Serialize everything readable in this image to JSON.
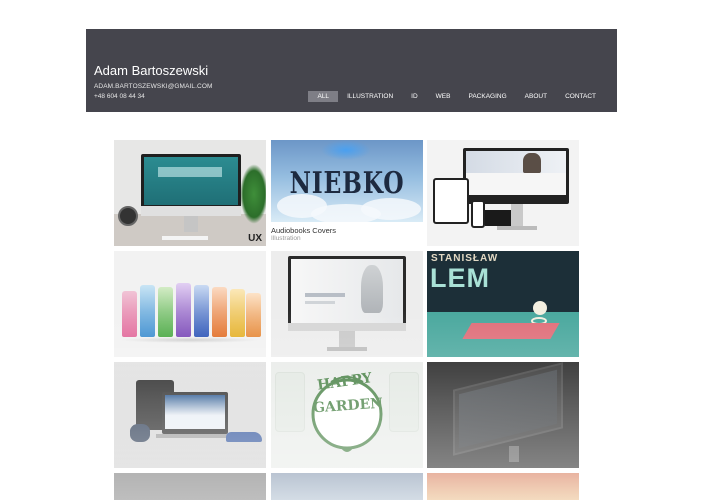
{
  "header": {
    "site_name": "Adam Bartoszewski",
    "email": "ADAM.BARTOSZEWSKI@GMAIL.COM",
    "phone": "+48 604 08 44 34",
    "bg_color": "#45454d",
    "nav": [
      {
        "label": "ALL",
        "active": true
      },
      {
        "label": "ILLUSTRATION",
        "active": false
      },
      {
        "label": "ID",
        "active": false
      },
      {
        "label": "WEB",
        "active": false
      },
      {
        "label": "PACKAGING",
        "active": false
      },
      {
        "label": "ABOUT",
        "active": false
      },
      {
        "label": "CONTACT",
        "active": false
      }
    ]
  },
  "grid": {
    "tiles": [
      {
        "id": "desk-monitor",
        "badge": "UX"
      },
      {
        "id": "niebko",
        "art_text": "NIEBKO",
        "caption_title": "Audiobooks Covers",
        "caption_sub": "Illustration"
      },
      {
        "id": "responsive-web"
      },
      {
        "id": "packaging-bottles"
      },
      {
        "id": "monalisa-monitor"
      },
      {
        "id": "stanislaw-lem",
        "art_text_1": "STANISŁAW",
        "art_text_2": "LEM"
      },
      {
        "id": "web-devices-bike"
      },
      {
        "id": "happy-garden",
        "art_text_1": "HAPPY",
        "art_text_2": "GARDEN"
      },
      {
        "id": "dark-monitor"
      }
    ]
  }
}
